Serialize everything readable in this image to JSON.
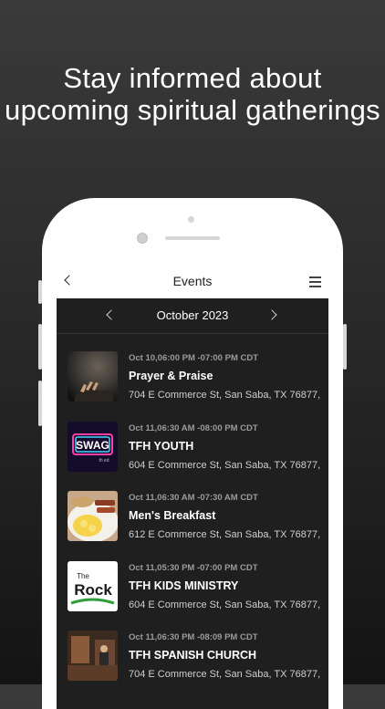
{
  "headline": "Stay informed about upcoming spiritual gatherings",
  "screen_header": {
    "title": "Events"
  },
  "calendar": {
    "month": "October 2023"
  },
  "events": [
    {
      "time": "Oct 10,06:00 PM -07:00 PM CDT",
      "title": "Prayer & Praise",
      "address": "704 E Commerce St, San Saba, TX 76877,",
      "image": "hands-praying-photo"
    },
    {
      "time": "Oct 11,06:30 AM -08:00 PM CDT",
      "title": "TFH YOUTH",
      "address": "604 E Commerce St, San Saba, TX 76877,",
      "image": "swag-youth-logo"
    },
    {
      "time": "Oct 11,06:30 AM -07:30 AM CDT",
      "title": "Men's Breakfast",
      "address": "612 E Commerce St, San Saba, TX 76877,",
      "image": "breakfast-plate-photo"
    },
    {
      "time": "Oct 11,05:30 PM -07:00 PM CDT",
      "title": "TFH KIDS MINISTRY",
      "address": "604 E Commerce St, San Saba, TX 76877,",
      "image": "the-rock-logo"
    },
    {
      "time": "Oct 11,06:30 PM -08:09 PM CDT",
      "title": "TFH SPANISH CHURCH",
      "address": "704 E Commerce St, San Saba, TX 76877,",
      "image": "church-interior-photo"
    }
  ],
  "logo_text": {
    "swag": "SWAG",
    "swag_sub": "th ed",
    "rock_the": "The",
    "rock_word": "Rock"
  }
}
